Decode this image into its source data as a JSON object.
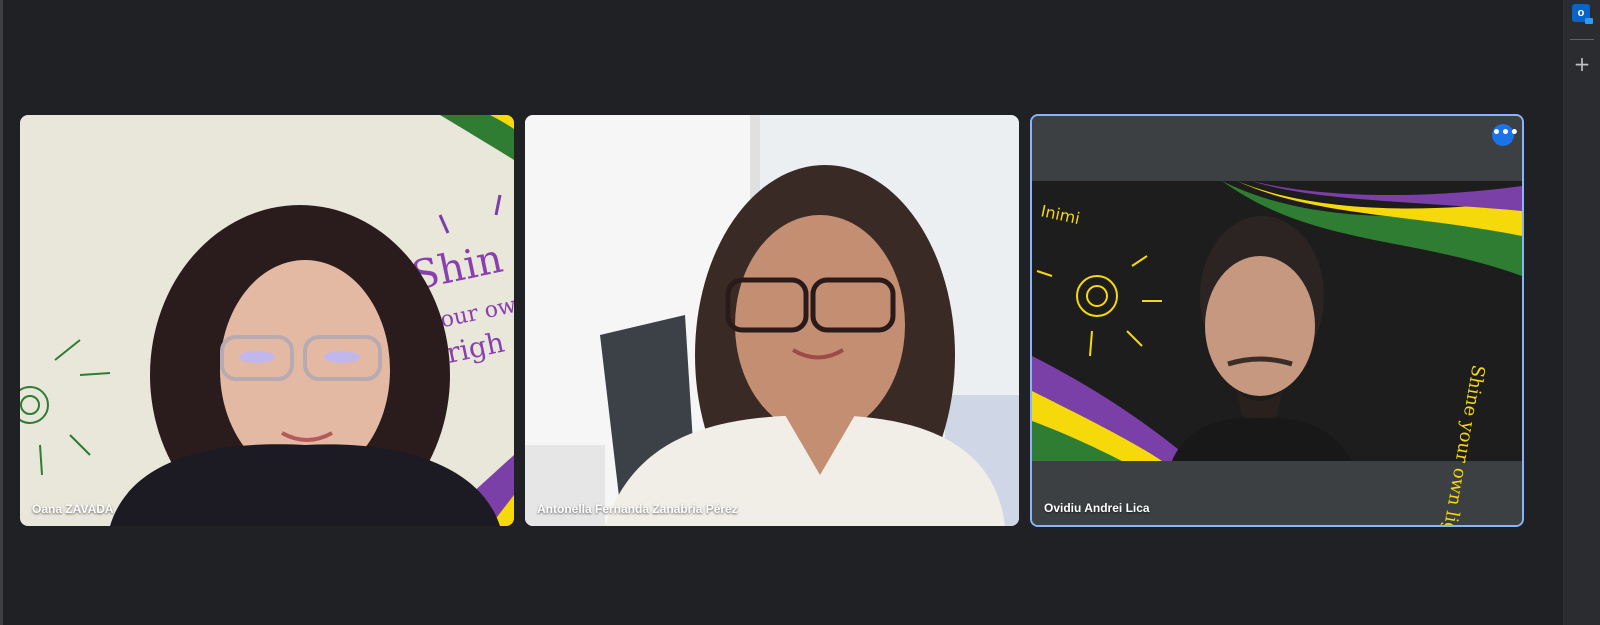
{
  "participants": [
    {
      "name": "Oana ZAVADA"
    },
    {
      "name": "Antonella Fernanda Zanabria Pérez"
    },
    {
      "name": "Ovidiu Andrei Lica"
    }
  ],
  "tile3": {
    "more_icon": "more-horiz-icon",
    "more_glyph": "•••"
  },
  "side_rail": {
    "outlook_glyph": "o",
    "add_glyph": "+"
  },
  "colors": {
    "background": "#202124",
    "tile": "#3c4043",
    "active_border": "#8ab4f8",
    "accent_blue": "#1a73e8",
    "brand_green": "#2f7d32",
    "brand_yellow": "#f5d90a",
    "brand_purple": "#7b3fa8"
  },
  "backgrounds": {
    "tile1_text": "Shine your own light",
    "tile3_text": "Shine your own light"
  }
}
